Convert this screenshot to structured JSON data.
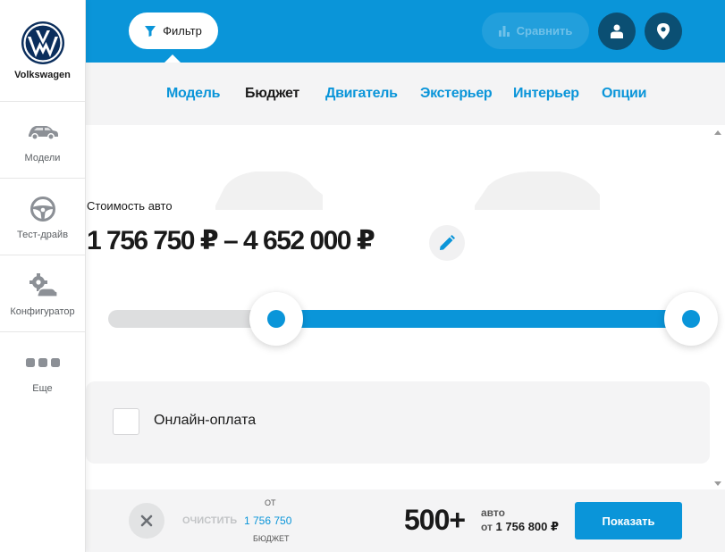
{
  "sidebar": {
    "brand": "Volkswagen",
    "items": [
      {
        "label": "Модели",
        "icon": "car-icon"
      },
      {
        "label": "Тест-драйв",
        "icon": "steering-wheel-icon"
      },
      {
        "label": "Конфигуратор",
        "icon": "configurator-icon"
      },
      {
        "label": "Еще",
        "icon": "more-icon"
      }
    ]
  },
  "topbar": {
    "filter_label": "Фильтр",
    "compare_label": "Сравнить"
  },
  "tabs": [
    "Модель",
    "Бюджет",
    "Двигатель",
    "Экстерьер",
    "Интерьер",
    "Опции"
  ],
  "active_tab": "Бюджет",
  "budget": {
    "label": "Стоимость авто",
    "range_text": "1 756 750 ₽ – 4 652 000 ₽",
    "slider_min_fraction": 0.27,
    "slider_max_fraction": 1.0
  },
  "online_payment": {
    "label": "Онлайн-оплата",
    "checked": false
  },
  "bottom": {
    "clear_label": "ОЧИСТИТЬ",
    "budget_prefix": "ОТ",
    "budget_value": "1 756 750",
    "budget_caption": "БЮДЖЕТ",
    "count": "500+",
    "count_unit": "авто",
    "price_prefix": "от",
    "price_value": "1 756 800 ₽",
    "show_label": "Показать"
  },
  "colors": {
    "accent": "#0a95d9",
    "dark_button": "#0b4f73",
    "panel": "#f4f4f5"
  }
}
